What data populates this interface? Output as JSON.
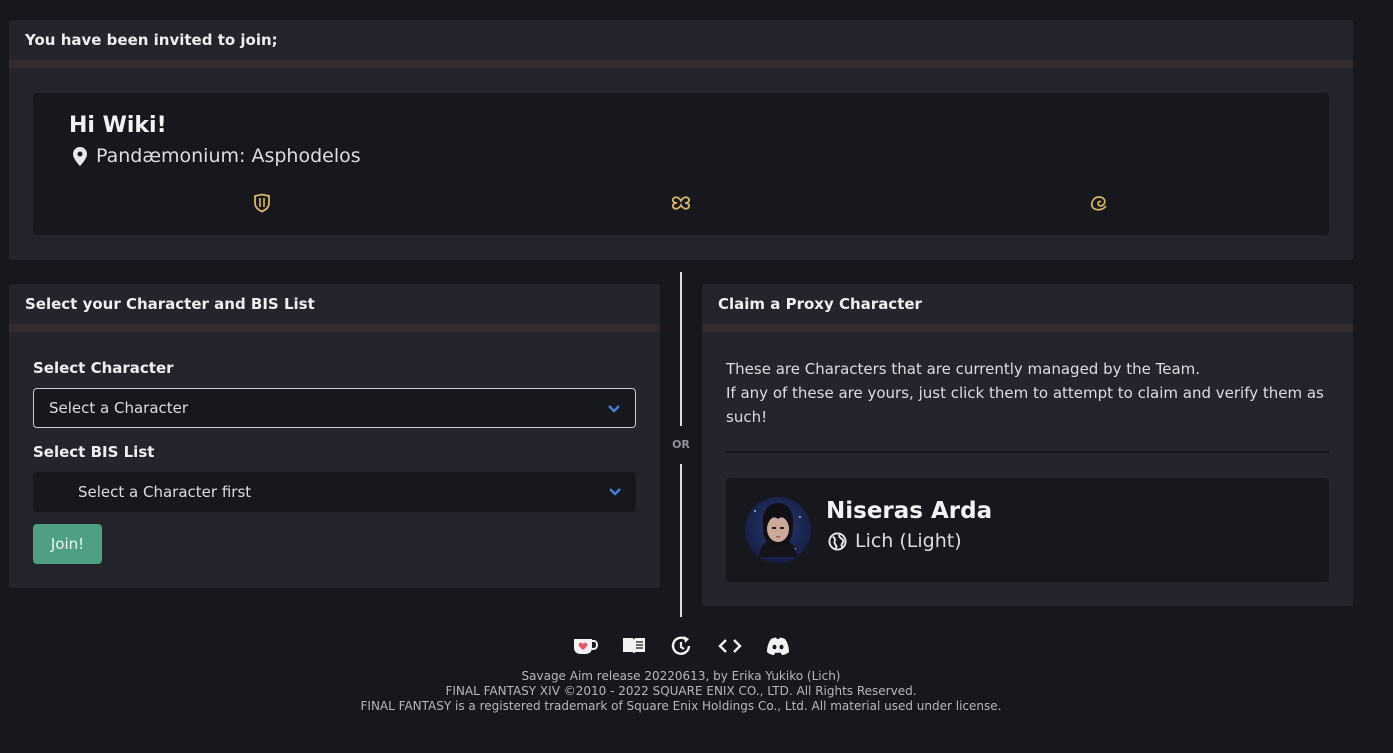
{
  "invite": {
    "header": "You have been invited to join;",
    "team_name": "Hi Wiki!",
    "tier": "Pandæmonium: Asphodelos",
    "roles": [
      "tank-icon",
      "healer-icon",
      "dps-icon"
    ]
  },
  "select": {
    "header": "Select your Character and BIS List",
    "character_label": "Select Character",
    "character_value": "Select a Character",
    "bis_label": "Select BIS List",
    "bis_value": "Select a Character first",
    "join_label": "Join!"
  },
  "divider": {
    "label": "OR"
  },
  "proxy": {
    "header": "Claim a Proxy Character",
    "description_line1": "These are Characters that are currently managed by the Team.",
    "description_line2": "If any of these are yours, just click them to attempt to claim and verify them as such!",
    "character": {
      "name": "Niseras Arda",
      "world": "Lich (Light)"
    }
  },
  "footer": {
    "icons": [
      "kofi-icon",
      "docs-icon",
      "changelog-icon",
      "code-icon",
      "discord-icon"
    ],
    "line1": "Savage Aim release 20220613, by Erika Yukiko (Lich)",
    "line2": "FINAL FANTASY XIV ©2010 - 2022 SQUARE ENIX CO., LTD. All Rights Reserved.",
    "line3": "FINAL FANTASY is a registered trademark of Square Enix Holdings Co., Ltd. All material used under license."
  },
  "colors": {
    "background": "#17181d",
    "card": "#24252c",
    "accent_green": "#4e9f84",
    "role_gold": "#d8b56a",
    "select_chevron": "#4a7fd6"
  }
}
